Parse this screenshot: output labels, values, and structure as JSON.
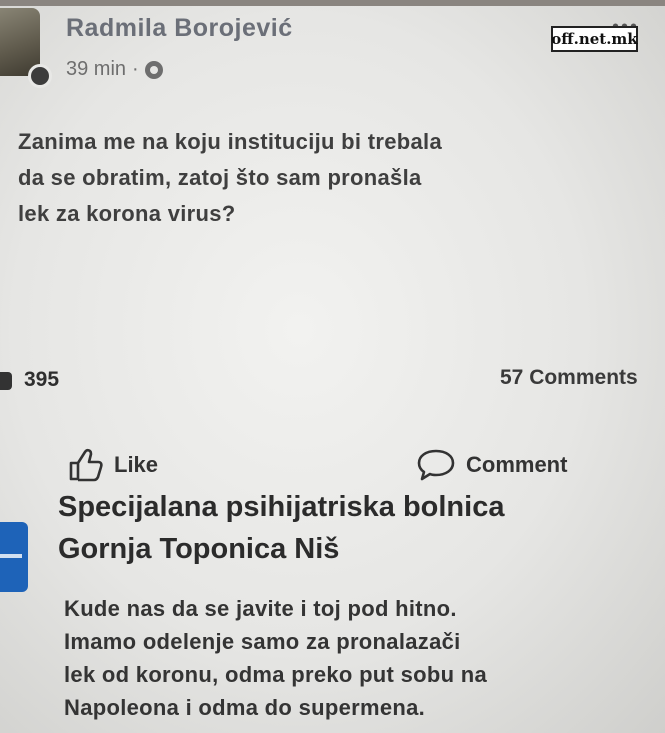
{
  "post": {
    "author": "Radmila Borojević",
    "time": "39 min",
    "separator": "·",
    "more": "•••",
    "text_lines": [
      "Zanima me na koju instituciju bi trebala",
      "da se obratim, zatoj što sam pronašla",
      "lek za korona virus?"
    ],
    "reactions": "395",
    "comments": "57 Comments"
  },
  "actions": {
    "like_label": "Like",
    "comment_label": "Comment"
  },
  "reply": {
    "name_lines": [
      "Specijalana psihijatriska bolnica",
      "Gornja Toponica Niš"
    ],
    "text_lines": [
      "Kude nas da se javite i toj pod hitno.",
      "Imamo odelenje samo za pronalazači",
      "lek od koronu, odma preko put sobu na",
      "Napoleona i odma do supermena."
    ]
  },
  "watermark": "off.net.mk",
  "colors": {
    "author_text": "#6b6f78",
    "reply_avatar": "#1e63b8"
  }
}
